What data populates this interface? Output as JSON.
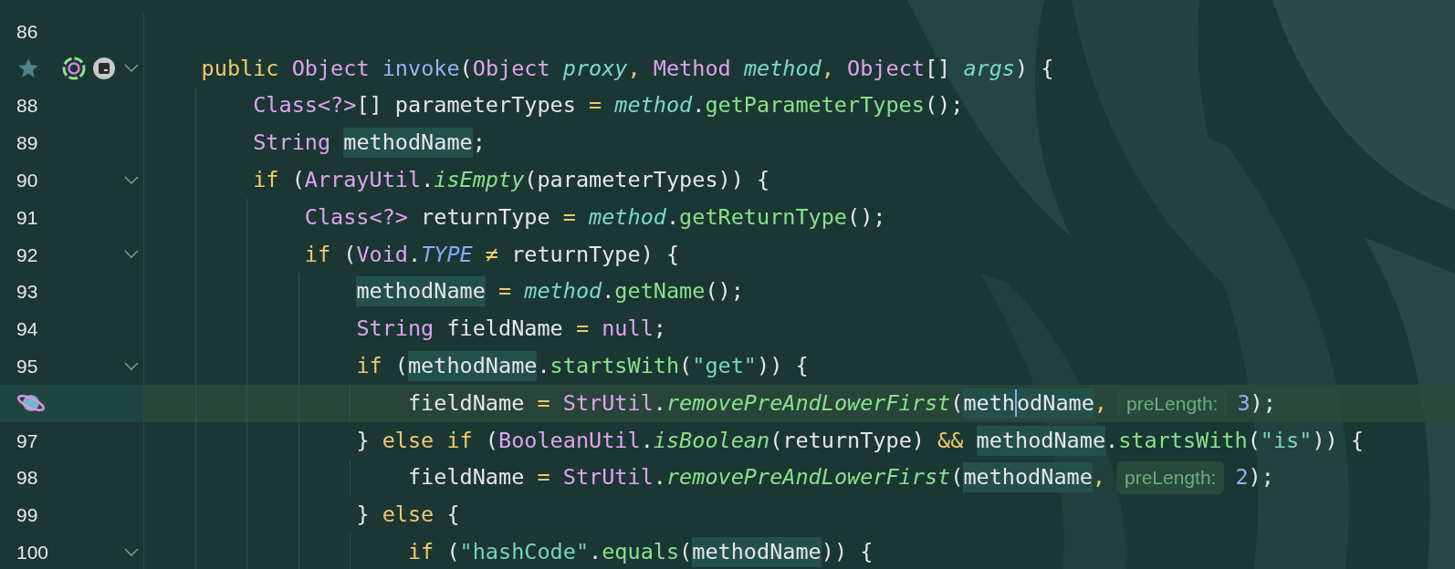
{
  "editor": {
    "lines": [
      {
        "number": "86",
        "foldable": false,
        "current": false
      },
      {
        "gutter_icons": [
          {
            "kind": "star"
          },
          {
            "kind": "ring"
          },
          {
            "kind": "terminal"
          }
        ],
        "foldable": true,
        "current": false,
        "tokens": [
          {
            "text": "    public ",
            "kind": "kw"
          },
          {
            "text": "Object ",
            "kind": "type"
          },
          {
            "text": "invoke",
            "kind": "fn"
          },
          {
            "text": "(",
            "kind": "plain"
          },
          {
            "text": "Object ",
            "kind": "type"
          },
          {
            "text": "proxy",
            "kind": "param"
          },
          {
            "text": ", ",
            "kind": "op"
          },
          {
            "text": "Method ",
            "kind": "type"
          },
          {
            "text": "method",
            "kind": "param"
          },
          {
            "text": ", ",
            "kind": "op"
          },
          {
            "text": "Object",
            "kind": "type"
          },
          {
            "text": "[] ",
            "kind": "plain"
          },
          {
            "text": "args",
            "kind": "param"
          },
          {
            "text": ") {",
            "kind": "plain"
          }
        ]
      },
      {
        "number": "88",
        "foldable": false,
        "current": false,
        "tokens": [
          {
            "text": "        Class<?>",
            "kind": "type"
          },
          {
            "text": "[] parameterTypes ",
            "kind": "plain"
          },
          {
            "text": "= ",
            "kind": "op"
          },
          {
            "text": "method",
            "kind": "param"
          },
          {
            "text": ".",
            "kind": "plain"
          },
          {
            "text": "getParameterTypes",
            "kind": "call"
          },
          {
            "text": "();",
            "kind": "plain"
          }
        ]
      },
      {
        "number": "89",
        "foldable": false,
        "current": false,
        "tokens": [
          {
            "text": "        String ",
            "kind": "type"
          },
          {
            "text": "methodName",
            "kind": "occurrence"
          },
          {
            "text": ";",
            "kind": "plain"
          }
        ]
      },
      {
        "number": "90",
        "foldable": true,
        "current": false,
        "tokens": [
          {
            "text": "        if",
            "kind": "kw"
          },
          {
            "text": " (",
            "kind": "plain"
          },
          {
            "text": "ArrayUtil",
            "kind": "type"
          },
          {
            "text": ".",
            "kind": "plain"
          },
          {
            "text": "isEmpty",
            "kind": "icall"
          },
          {
            "text": "(parameterTypes)) {",
            "kind": "plain"
          }
        ]
      },
      {
        "number": "91",
        "foldable": false,
        "current": false,
        "tokens": [
          {
            "text": "            Class<?>",
            "kind": "type"
          },
          {
            "text": " returnType ",
            "kind": "plain"
          },
          {
            "text": "= ",
            "kind": "op"
          },
          {
            "text": "method",
            "kind": "param"
          },
          {
            "text": ".",
            "kind": "plain"
          },
          {
            "text": "getReturnType",
            "kind": "call"
          },
          {
            "text": "();",
            "kind": "plain"
          }
        ]
      },
      {
        "number": "92",
        "foldable": true,
        "current": false,
        "tokens": [
          {
            "text": "            if",
            "kind": "kw"
          },
          {
            "text": " (",
            "kind": "plain"
          },
          {
            "text": "Void",
            "kind": "type"
          },
          {
            "text": ".",
            "kind": "plain"
          },
          {
            "text": "TYPE",
            "kind": "const"
          },
          {
            "text": " ≠",
            "kind": "op"
          },
          {
            "text": " returnType) {",
            "kind": "plain"
          }
        ]
      },
      {
        "number": "93",
        "foldable": false,
        "current": false,
        "tokens": [
          {
            "text": "                methodName",
            "kind": "occurrence"
          },
          {
            "text": " = ",
            "kind": "op"
          },
          {
            "text": "method",
            "kind": "param"
          },
          {
            "text": ".",
            "kind": "plain"
          },
          {
            "text": "getName",
            "kind": "call"
          },
          {
            "text": "();",
            "kind": "plain"
          }
        ]
      },
      {
        "number": "94",
        "foldable": false,
        "current": false,
        "tokens": [
          {
            "text": "                String ",
            "kind": "type"
          },
          {
            "text": "fieldName ",
            "kind": "plain"
          },
          {
            "text": "= ",
            "kind": "op"
          },
          {
            "text": "null",
            "kind": "literal"
          },
          {
            "text": ";",
            "kind": "plain"
          }
        ]
      },
      {
        "number": "95",
        "foldable": true,
        "current": false,
        "tokens": [
          {
            "text": "                if",
            "kind": "kw"
          },
          {
            "text": " (",
            "kind": "plain"
          },
          {
            "text": "methodName",
            "kind": "occurrence"
          },
          {
            "text": ".",
            "kind": "plain"
          },
          {
            "text": "startsWith",
            "kind": "call"
          },
          {
            "text": "(",
            "kind": "plain"
          },
          {
            "text": "\"get\"",
            "kind": "str"
          },
          {
            "text": ")) {",
            "kind": "plain"
          }
        ]
      },
      {
        "gutter_icons": [
          {
            "kind": "planet"
          }
        ],
        "foldable": false,
        "current": true,
        "tokens": [
          {
            "text": "                    fieldName ",
            "kind": "plain"
          },
          {
            "text": "= ",
            "kind": "op"
          },
          {
            "text": "StrUtil",
            "kind": "type"
          },
          {
            "text": ".",
            "kind": "plain"
          },
          {
            "text": "removePreAndLowerFirst",
            "kind": "icall"
          },
          {
            "text": "(",
            "kind": "plain"
          },
          {
            "text": "meth",
            "kind": "occurrence"
          },
          {
            "kind": "caret"
          },
          {
            "text": "odName",
            "kind": "occurrence"
          },
          {
            "text": ",",
            "kind": "op"
          },
          {
            "text": "preLength:",
            "kind": "hint"
          },
          {
            "text": "3",
            "kind": "num"
          },
          {
            "text": ");",
            "kind": "plain"
          }
        ]
      },
      {
        "number": "97",
        "foldable": false,
        "current": false,
        "tokens": [
          {
            "text": "                } ",
            "kind": "plain"
          },
          {
            "text": "else if",
            "kind": "kw"
          },
          {
            "text": " (",
            "kind": "plain"
          },
          {
            "text": "BooleanUtil",
            "kind": "type"
          },
          {
            "text": ".",
            "kind": "plain"
          },
          {
            "text": "isBoolean",
            "kind": "icall"
          },
          {
            "text": "(returnType) ",
            "kind": "plain"
          },
          {
            "text": "&& ",
            "kind": "op"
          },
          {
            "text": "methodName",
            "kind": "occurrence"
          },
          {
            "text": ".",
            "kind": "plain"
          },
          {
            "text": "startsWith",
            "kind": "call"
          },
          {
            "text": "(",
            "kind": "plain"
          },
          {
            "text": "\"is\"",
            "kind": "str"
          },
          {
            "text": ")) {",
            "kind": "plain"
          }
        ]
      },
      {
        "number": "98",
        "foldable": false,
        "current": false,
        "tokens": [
          {
            "text": "                    fieldName ",
            "kind": "plain"
          },
          {
            "text": "= ",
            "kind": "op"
          },
          {
            "text": "StrUtil",
            "kind": "type"
          },
          {
            "text": ".",
            "kind": "plain"
          },
          {
            "text": "removePreAndLowerFirst",
            "kind": "icall"
          },
          {
            "text": "(",
            "kind": "plain"
          },
          {
            "text": "methodName",
            "kind": "occurrence"
          },
          {
            "text": ",",
            "kind": "op"
          },
          {
            "text": "preLength:",
            "kind": "hint"
          },
          {
            "text": "2",
            "kind": "num"
          },
          {
            "text": ");",
            "kind": "plain"
          }
        ]
      },
      {
        "number": "99",
        "foldable": false,
        "current": false,
        "tokens": [
          {
            "text": "                } ",
            "kind": "plain"
          },
          {
            "text": "else",
            "kind": "kw"
          },
          {
            "text": " {",
            "kind": "plain"
          }
        ]
      },
      {
        "number": "100",
        "foldable": true,
        "current": false,
        "tokens": [
          {
            "text": "                    if",
            "kind": "kw"
          },
          {
            "text": " (",
            "kind": "plain"
          },
          {
            "text": "\"hashCode\"",
            "kind": "str"
          },
          {
            "text": ".",
            "kind": "plain"
          },
          {
            "text": "equals",
            "kind": "call"
          },
          {
            "text": "(",
            "kind": "plain"
          },
          {
            "text": "methodName",
            "kind": "occurrence"
          },
          {
            "text": ")) {",
            "kind": "plain"
          }
        ]
      }
    ]
  }
}
